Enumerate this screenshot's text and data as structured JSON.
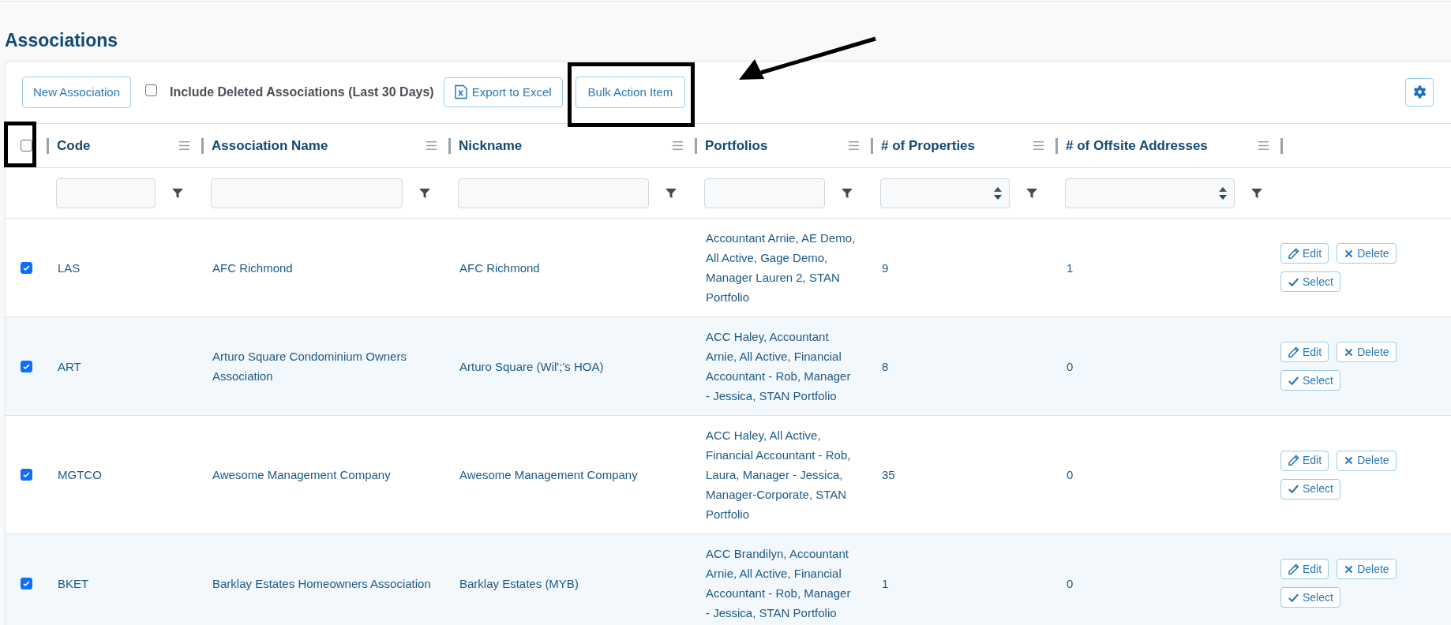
{
  "page": {
    "title": "Associations"
  },
  "toolbar": {
    "new_button": "New Association",
    "include_deleted": {
      "label": "Include Deleted Associations (Last 30 Days)",
      "checked": false
    },
    "export_button": "Export to Excel",
    "bulk_button": {
      "label": "Bulk Action Item",
      "highlighted": true
    }
  },
  "pointer_arrow": true,
  "table": {
    "select_all": {
      "checked": false,
      "highlighted": true
    },
    "columns": [
      {
        "label": "Code",
        "kind": "text"
      },
      {
        "label": "Association Name",
        "kind": "text"
      },
      {
        "label": "Nickname",
        "kind": "text"
      },
      {
        "label": "Portfolios",
        "kind": "text"
      },
      {
        "label": "# of Properties",
        "kind": "number"
      },
      {
        "label": "# of Offsite Addresses",
        "kind": "number"
      }
    ],
    "rows": [
      {
        "selected": true,
        "cells": [
          "LAS",
          "AFC Richmond",
          "AFC Richmond",
          "Accountant Arnie, AE Demo, All Active, Gage Demo, Manager Lauren 2, STAN Portfolio",
          "9",
          "1"
        ],
        "actions": [
          {
            "kind": "edit",
            "label": "Edit"
          },
          {
            "kind": "delete",
            "label": "Delete"
          },
          {
            "kind": "select",
            "label": "Select"
          }
        ]
      },
      {
        "selected": true,
        "cells": [
          "ART",
          "Arturo Square Condominium Owners Association",
          "Arturo Square (Wil';'s HOA)",
          "ACC Haley, Accountant Arnie, All Active, Financial Accountant - Rob, Manager - Jessica, STAN Portfolio",
          "8",
          "0"
        ],
        "actions": [
          {
            "kind": "edit",
            "label": "Edit"
          },
          {
            "kind": "delete",
            "label": "Delete"
          },
          {
            "kind": "select",
            "label": "Select"
          }
        ]
      },
      {
        "selected": true,
        "cells": [
          "MGTCO",
          "Awesome Management Company",
          "Awesome Management Company",
          "ACC Haley, All Active, Financial Accountant - Rob, Laura, Manager - Jessica, Manager-Corporate, STAN Portfolio",
          "35",
          "0"
        ],
        "actions": [
          {
            "kind": "edit",
            "label": "Edit"
          },
          {
            "kind": "delete",
            "label": "Delete"
          },
          {
            "kind": "select",
            "label": "Select"
          }
        ]
      },
      {
        "selected": true,
        "cells": [
          "BKET",
          "Barklay Estates Homeowners Association",
          "Barklay Estates (MYB)",
          "ACC Brandilyn, Accountant Arnie, All Active, Financial Accountant - Rob, Manager - Jessica, STAN Portfolio",
          "1",
          "0"
        ],
        "actions": [
          {
            "kind": "edit",
            "label": "Edit"
          },
          {
            "kind": "delete",
            "label": "Delete"
          },
          {
            "kind": "select",
            "label": "Select"
          }
        ]
      }
    ]
  }
}
